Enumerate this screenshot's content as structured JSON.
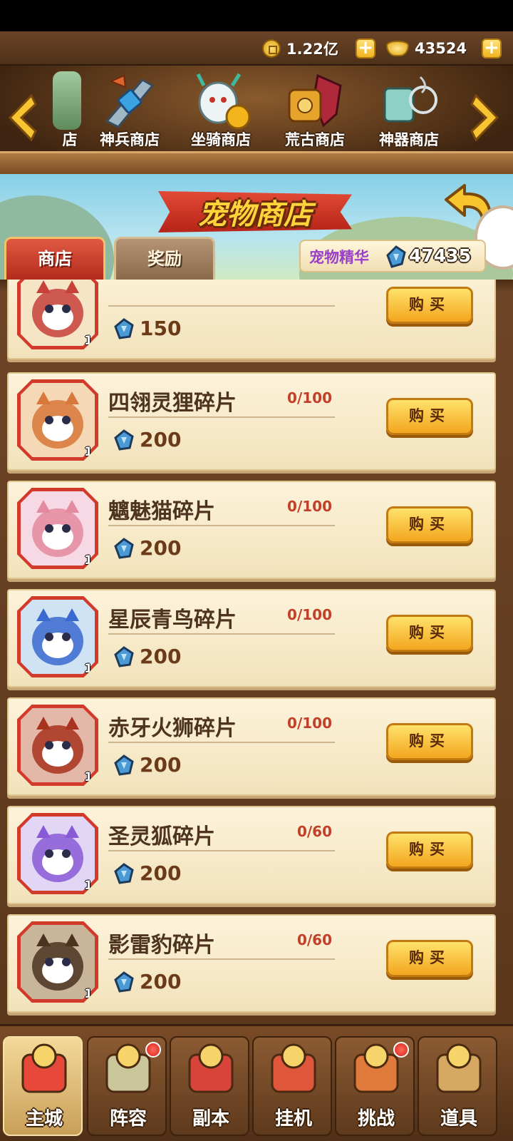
{
  "resources": {
    "gold": "1.22亿",
    "ingot": "43524"
  },
  "shop_categories": [
    {
      "label": "店",
      "icon": "shop-icon"
    },
    {
      "label": "神兵商店",
      "icon": "weapon-icon"
    },
    {
      "label": "坐骑商店",
      "icon": "mount-icon"
    },
    {
      "label": "荒古商店",
      "icon": "ancient-icon"
    },
    {
      "label": "神器商店",
      "icon": "artifact-icon"
    }
  ],
  "header": {
    "title": "宠物商店",
    "tabs": [
      {
        "label": "商店",
        "active": true
      },
      {
        "label": "奖励",
        "active": false
      }
    ],
    "essence_label": "宠物精华",
    "essence_value": "47435"
  },
  "items": [
    {
      "name": "",
      "progress": "",
      "price": "150",
      "count": "1",
      "buy_label": "购买"
    },
    {
      "name": "四翎灵狸碎片",
      "progress": "0/100",
      "price": "200",
      "count": "1",
      "buy_label": "购买"
    },
    {
      "name": "魑魅猫碎片",
      "progress": "0/100",
      "price": "200",
      "count": "1",
      "buy_label": "购买"
    },
    {
      "name": "星辰青鸟碎片",
      "progress": "0/100",
      "price": "200",
      "count": "1",
      "buy_label": "购买"
    },
    {
      "name": "赤牙火狮碎片",
      "progress": "0/100",
      "price": "200",
      "count": "1",
      "buy_label": "购买"
    },
    {
      "name": "圣灵狐碎片",
      "progress": "0/60",
      "price": "200",
      "count": "1",
      "buy_label": "购买"
    },
    {
      "name": "影雷豹碎片",
      "progress": "0/60",
      "price": "200",
      "count": "1",
      "buy_label": "购买"
    }
  ],
  "bottom_nav": [
    {
      "label": "主城",
      "active": true,
      "badge": false
    },
    {
      "label": "阵容",
      "active": false,
      "badge": true
    },
    {
      "label": "副本",
      "active": false,
      "badge": false
    },
    {
      "label": "挂机",
      "active": false,
      "badge": false
    },
    {
      "label": "挑战",
      "active": false,
      "badge": true
    },
    {
      "label": "道具",
      "active": false,
      "badge": false
    }
  ],
  "colors": {
    "accent_red": "#d23b2c",
    "button_gold": "#f3a51e",
    "essence_purple": "#9a3fc7"
  }
}
